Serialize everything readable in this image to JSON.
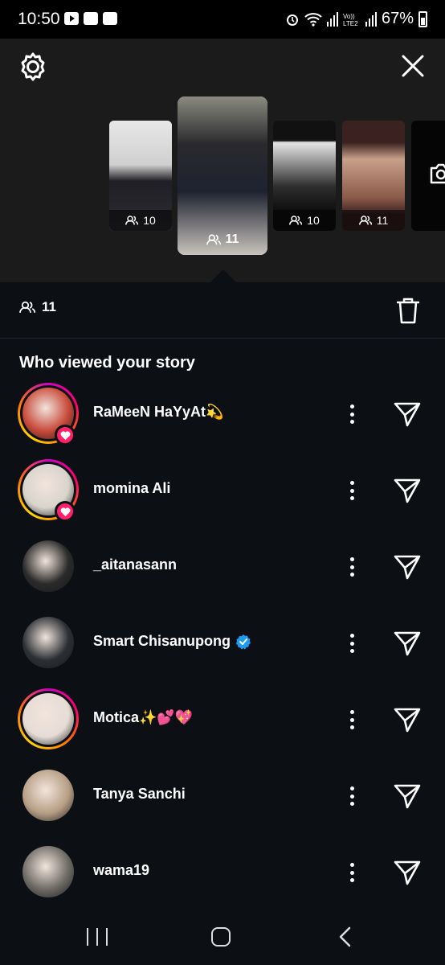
{
  "status_bar": {
    "time": "10:50",
    "battery": "67%",
    "icons": [
      "youtube-icon",
      "gallery-icon",
      "checkbox-icon",
      "alarm-icon",
      "wifi-icon",
      "signal-icon",
      "volte-icon",
      "battery-icon"
    ]
  },
  "header": {
    "settings_icon": "gear-icon",
    "close_icon": "close-icon",
    "stories": [
      {
        "views": "10"
      },
      {
        "views": "11",
        "selected": true
      },
      {
        "views": "10"
      },
      {
        "views": "11"
      },
      {
        "icon": "camera-icon"
      }
    ]
  },
  "summary": {
    "viewer_count": "11",
    "delete_icon": "trash-icon"
  },
  "section_title": "Who viewed your story",
  "viewers": [
    {
      "name": "RaMeeN HaYyAt💫",
      "liked": true,
      "ring": true,
      "avatar_color": "#c84a3a"
    },
    {
      "name": "momina Ali",
      "liked": true,
      "ring": true,
      "avatar_color": "#d8d4cc"
    },
    {
      "name": "_aitanasann",
      "liked": false,
      "ring": false,
      "avatar_color": "#2a2a2a"
    },
    {
      "name": "Smart Chisanupong",
      "liked": false,
      "ring": false,
      "verified": true,
      "avatar_color": "#2b2f34"
    },
    {
      "name": "Motica✨💕💖",
      "liked": false,
      "ring": true,
      "avatar_color": "#e6dcd6"
    },
    {
      "name": "Tanya Sanchi",
      "liked": false,
      "ring": false,
      "avatar_color": "#b79f86"
    },
    {
      "name": "wama19",
      "liked": false,
      "ring": false,
      "avatar_color": "#6d6a64"
    }
  ],
  "colors": {
    "background": "#0c0f14",
    "header_bg": "#1b1b1b",
    "like_badge": "#ff1f6b",
    "verified": "#1d9bf0"
  }
}
